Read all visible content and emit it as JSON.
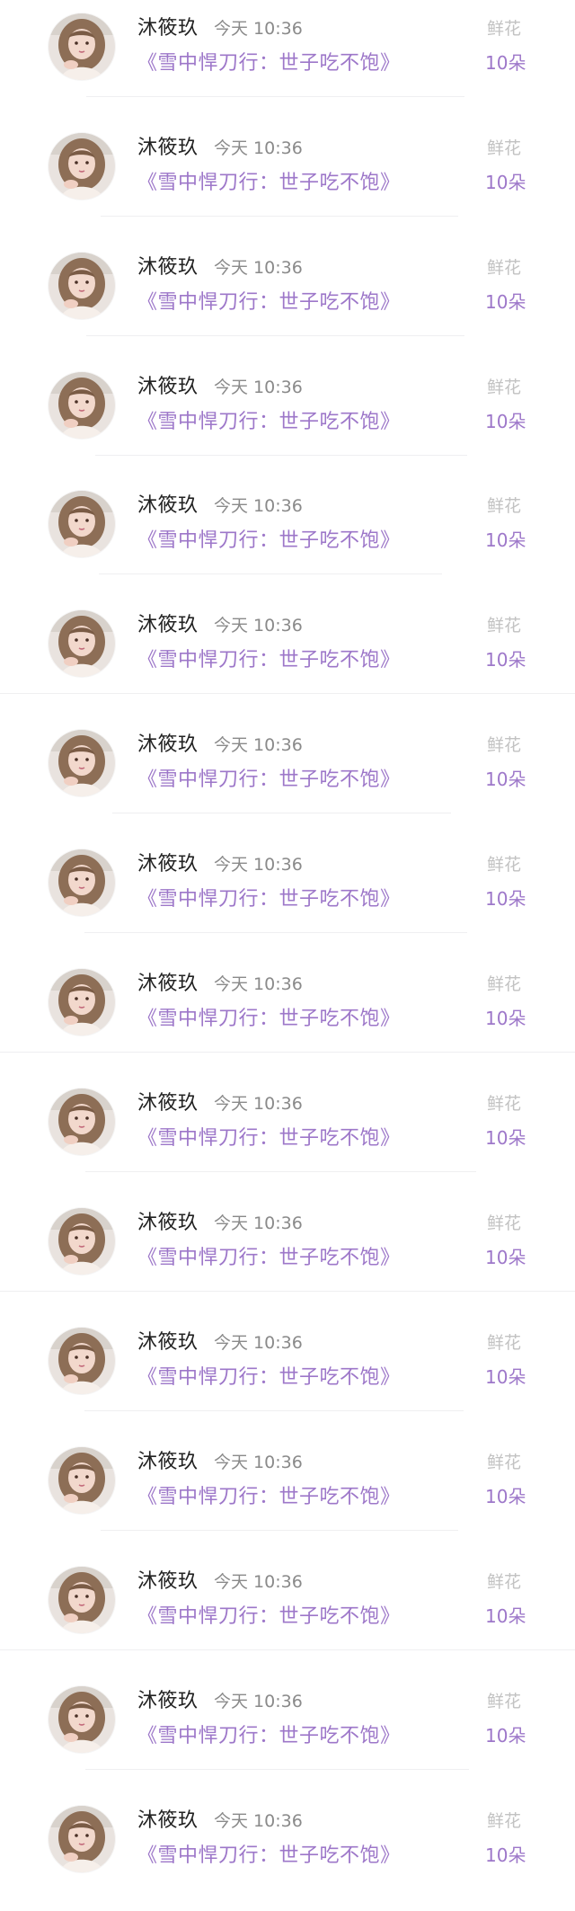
{
  "colors": {
    "name_text": "#222222",
    "time_text": "#8a8a8a",
    "accent_purple": "#9d77c9",
    "gift_label": "#c2c2c2",
    "divider": "#efeff1",
    "background": "#ffffff"
  },
  "items": [
    {
      "user": "沐筱玖",
      "time": "今天 10:36",
      "book": "《雪中悍刀行：世子吃不饱》",
      "gift": "鲜花",
      "count": "10朵",
      "avatar_icon": "user-avatar-photo"
    },
    {
      "user": "沐筱玖",
      "time": "今天 10:36",
      "book": "《雪中悍刀行：世子吃不饱》",
      "gift": "鲜花",
      "count": "10朵",
      "avatar_icon": "user-avatar-photo"
    },
    {
      "user": "沐筱玖",
      "time": "今天 10:36",
      "book": "《雪中悍刀行：世子吃不饱》",
      "gift": "鲜花",
      "count": "10朵",
      "avatar_icon": "user-avatar-photo"
    },
    {
      "user": "沐筱玖",
      "time": "今天 10:36",
      "book": "《雪中悍刀行：世子吃不饱》",
      "gift": "鲜花",
      "count": "10朵",
      "avatar_icon": "user-avatar-photo"
    },
    {
      "user": "沐筱玖",
      "time": "今天 10:36",
      "book": "《雪中悍刀行：世子吃不饱》",
      "gift": "鲜花",
      "count": "10朵",
      "avatar_icon": "user-avatar-photo"
    },
    {
      "user": "沐筱玖",
      "time": "今天 10:36",
      "book": "《雪中悍刀行：世子吃不饱》",
      "gift": "鲜花",
      "count": "10朵",
      "avatar_icon": "user-avatar-photo"
    },
    {
      "user": "沐筱玖",
      "time": "今天 10:36",
      "book": "《雪中悍刀行：世子吃不饱》",
      "gift": "鲜花",
      "count": "10朵",
      "avatar_icon": "user-avatar-photo"
    },
    {
      "user": "沐筱玖",
      "time": "今天 10:36",
      "book": "《雪中悍刀行：世子吃不饱》",
      "gift": "鲜花",
      "count": "10朵",
      "avatar_icon": "user-avatar-photo"
    },
    {
      "user": "沐筱玖",
      "time": "今天 10:36",
      "book": "《雪中悍刀行：世子吃不饱》",
      "gift": "鲜花",
      "count": "10朵",
      "avatar_icon": "user-avatar-photo"
    },
    {
      "user": "沐筱玖",
      "time": "今天 10:36",
      "book": "《雪中悍刀行：世子吃不饱》",
      "gift": "鲜花",
      "count": "10朵",
      "avatar_icon": "user-avatar-photo"
    },
    {
      "user": "沐筱玖",
      "time": "今天 10:36",
      "book": "《雪中悍刀行：世子吃不饱》",
      "gift": "鲜花",
      "count": "10朵",
      "avatar_icon": "user-avatar-photo"
    },
    {
      "user": "沐筱玖",
      "time": "今天 10:36",
      "book": "《雪中悍刀行：世子吃不饱》",
      "gift": "鲜花",
      "count": "10朵",
      "avatar_icon": "user-avatar-photo"
    },
    {
      "user": "沐筱玖",
      "time": "今天 10:36",
      "book": "《雪中悍刀行：世子吃不饱》",
      "gift": "鲜花",
      "count": "10朵",
      "avatar_icon": "user-avatar-photo"
    },
    {
      "user": "沐筱玖",
      "time": "今天 10:36",
      "book": "《雪中悍刀行：世子吃不饱》",
      "gift": "鲜花",
      "count": "10朵",
      "avatar_icon": "user-avatar-photo"
    },
    {
      "user": "沐筱玖",
      "time": "今天 10:36",
      "book": "《雪中悍刀行：世子吃不饱》",
      "gift": "鲜花",
      "count": "10朵",
      "avatar_icon": "user-avatar-photo"
    },
    {
      "user": "沐筱玖",
      "time": "今天 10:36",
      "book": "《雪中悍刀行：世子吃不饱》",
      "gift": "鲜花",
      "count": "10朵",
      "avatar_icon": "user-avatar-photo"
    }
  ]
}
